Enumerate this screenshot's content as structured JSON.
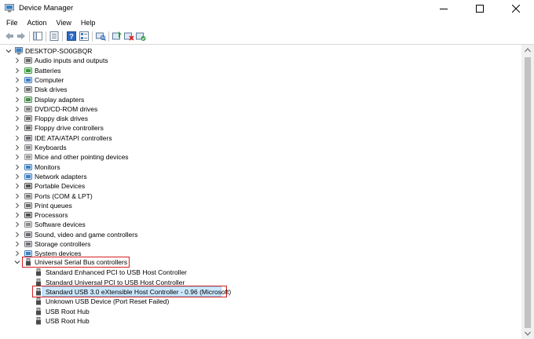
{
  "window": {
    "title": "Device Manager"
  },
  "menu": [
    "File",
    "Action",
    "View",
    "Help"
  ],
  "tree": {
    "root": "DESKTOP-SO0GBQR",
    "categories": [
      {
        "label": "Audio inputs and outputs",
        "icon": "audio-icon"
      },
      {
        "label": "Batteries",
        "icon": "battery-icon"
      },
      {
        "label": "Computer",
        "icon": "computer-icon"
      },
      {
        "label": "Disk drives",
        "icon": "disk-drive-icon"
      },
      {
        "label": "Display adapters",
        "icon": "display-adapter-icon"
      },
      {
        "label": "DVD/CD-ROM drives",
        "icon": "dvd-drive-icon"
      },
      {
        "label": "Floppy disk drives",
        "icon": "floppy-disk-icon"
      },
      {
        "label": "Floppy drive controllers",
        "icon": "floppy-controller-icon"
      },
      {
        "label": "IDE ATA/ATAPI controllers",
        "icon": "ide-controller-icon"
      },
      {
        "label": "Keyboards",
        "icon": "keyboard-icon"
      },
      {
        "label": "Mice and other pointing devices",
        "icon": "mouse-icon"
      },
      {
        "label": "Monitors",
        "icon": "monitor-icon"
      },
      {
        "label": "Network adapters",
        "icon": "network-adapter-icon"
      },
      {
        "label": "Portable Devices",
        "icon": "portable-device-icon"
      },
      {
        "label": "Ports (COM & LPT)",
        "icon": "port-icon"
      },
      {
        "label": "Print queues",
        "icon": "printer-icon"
      },
      {
        "label": "Processors",
        "icon": "processor-icon"
      },
      {
        "label": "Software devices",
        "icon": "software-device-icon"
      },
      {
        "label": "Sound, video and game controllers",
        "icon": "sound-icon"
      },
      {
        "label": "Storage controllers",
        "icon": "storage-controller-icon"
      },
      {
        "label": "System devices",
        "icon": "system-device-icon"
      }
    ],
    "usb": {
      "label": "Universal Serial Bus controllers",
      "children": [
        "Standard Enhanced PCI to USB Host Controller",
        "Standard Universal PCI to USB Host Controller",
        "Standard USB 3.0 eXtensible Host Controller - 0.96 (Microsoft)",
        "Unknown USB Device (Port Reset Failed)",
        "USB Root Hub",
        "USB Root Hub"
      ],
      "selected_index": 2
    }
  },
  "colors": {
    "highlight": "#d32020",
    "selection": "#cce8ff"
  }
}
